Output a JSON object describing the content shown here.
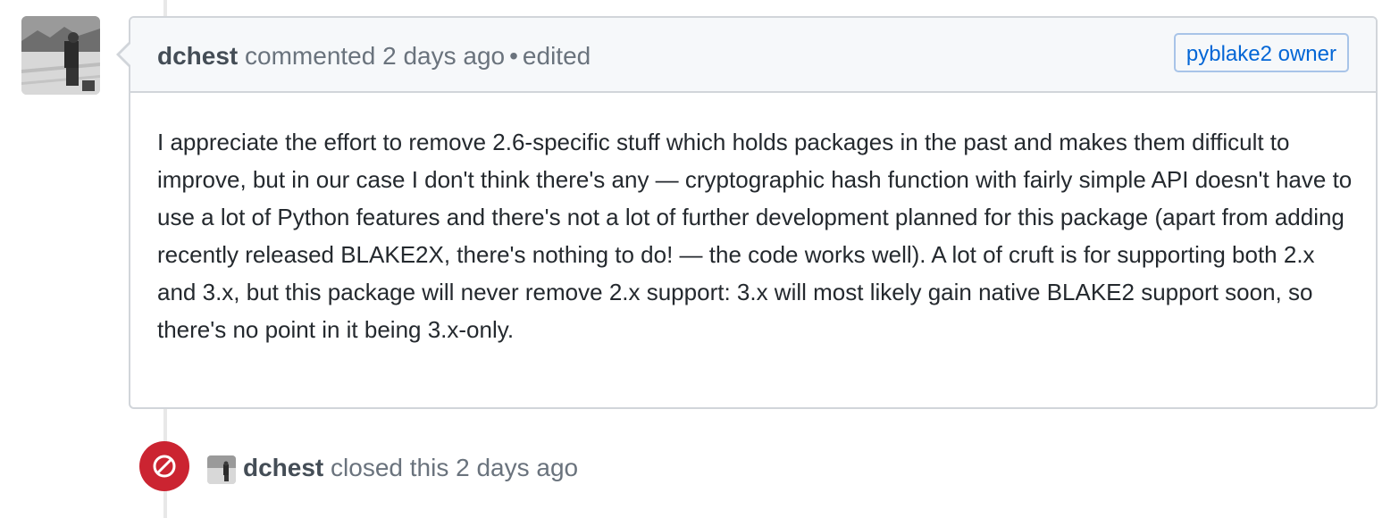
{
  "comment": {
    "author": "dchest",
    "action": "commented",
    "time": "2 days ago",
    "separator": "•",
    "edited": "edited",
    "badge": "pyblake2 owner",
    "body": "I appreciate the effort to remove 2.6-specific stuff which holds packages in the past and makes them difficult to improve, but in our case I don't think there's any — cryptographic hash function with fairly simple API doesn't have to use a lot of Python features and there's not a lot of further development planned for this package (apart from adding recently released BLAKE2X, there's nothing to do! — the code works well). A lot of cruft is for supporting both 2.x and 3.x, but this package will never remove 2.x support: 3.x will most likely gain native BLAKE2 support soon, so there's no point in it being 3.x-only."
  },
  "event": {
    "author": "dchest",
    "text": "closed this 2 days ago",
    "icon": "circle-slash-icon",
    "color": "#cb2431"
  }
}
